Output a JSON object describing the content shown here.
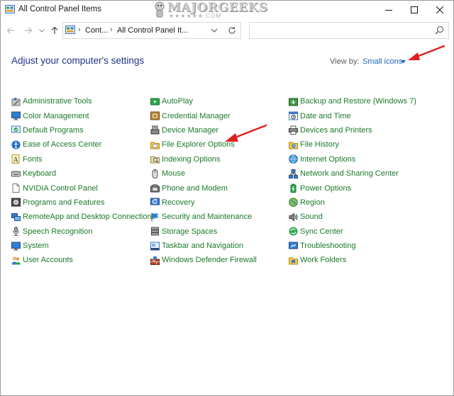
{
  "window": {
    "title": "All Control Panel Items"
  },
  "watermark": {
    "text": "MAJORGEEKS",
    "stars": "★★★★★★.COM"
  },
  "address": {
    "crumb1": "Cont...",
    "crumb2": "All Control Panel It...",
    "separator": "›"
  },
  "search": {
    "value": "",
    "placeholder": ""
  },
  "header": {
    "heading": "Adjust your computer's settings",
    "view_by_label": "View by:",
    "view_by_value": "Small icons"
  },
  "columns": [
    [
      {
        "label": "Administrative Tools",
        "icon": "admin-tools"
      },
      {
        "label": "Color Management",
        "icon": "monitor"
      },
      {
        "label": "Default Programs",
        "icon": "default-programs"
      },
      {
        "label": "Ease of Access Center",
        "icon": "ease-access"
      },
      {
        "label": "Fonts",
        "icon": "fonts"
      },
      {
        "label": "Keyboard",
        "icon": "keyboard"
      },
      {
        "label": "NVIDIA Control Panel",
        "icon": "document"
      },
      {
        "label": "Programs and Features",
        "icon": "programs"
      },
      {
        "label": "RemoteApp and Desktop Connections",
        "icon": "remote"
      },
      {
        "label": "Speech Recognition",
        "icon": "microphone"
      },
      {
        "label": "System",
        "icon": "monitor"
      },
      {
        "label": "User Accounts",
        "icon": "users"
      }
    ],
    [
      {
        "label": "AutoPlay",
        "icon": "autoplay"
      },
      {
        "label": "Credential Manager",
        "icon": "credential"
      },
      {
        "label": "Device Manager",
        "icon": "device-manager"
      },
      {
        "label": "File Explorer Options",
        "icon": "folder-options"
      },
      {
        "label": "Indexing Options",
        "icon": "indexing"
      },
      {
        "label": "Mouse",
        "icon": "mouse"
      },
      {
        "label": "Phone and Modem",
        "icon": "phone"
      },
      {
        "label": "Recovery",
        "icon": "recovery"
      },
      {
        "label": "Security and Maintenance",
        "icon": "flag"
      },
      {
        "label": "Storage Spaces",
        "icon": "storage"
      },
      {
        "label": "Taskbar and Navigation",
        "icon": "taskbar"
      },
      {
        "label": "Windows Defender Firewall",
        "icon": "firewall"
      }
    ],
    [
      {
        "label": "Backup and Restore (Windows 7)",
        "icon": "backup"
      },
      {
        "label": "Date and Time",
        "icon": "datetime"
      },
      {
        "label": "Devices and Printers",
        "icon": "printer"
      },
      {
        "label": "File History",
        "icon": "file-history"
      },
      {
        "label": "Internet Options",
        "icon": "internet"
      },
      {
        "label": "Network and Sharing Center",
        "icon": "network"
      },
      {
        "label": "Power Options",
        "icon": "power"
      },
      {
        "label": "Region",
        "icon": "region"
      },
      {
        "label": "Sound",
        "icon": "sound"
      },
      {
        "label": "Sync Center",
        "icon": "sync"
      },
      {
        "label": "Troubleshooting",
        "icon": "troubleshoot"
      },
      {
        "label": "Work Folders",
        "icon": "work-folders"
      }
    ]
  ],
  "colors": {
    "accent": "#2266bb",
    "heading": "#1e3287",
    "link": "#1b7a2a",
    "annotation_arrow": "#e02020"
  }
}
